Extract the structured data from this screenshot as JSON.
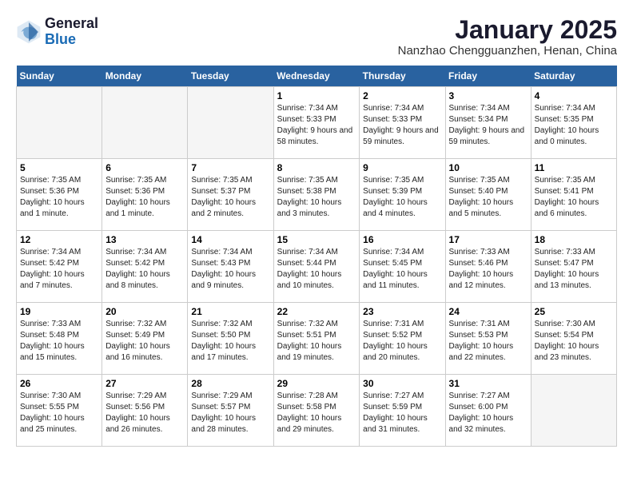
{
  "header": {
    "logo_general": "General",
    "logo_blue": "Blue",
    "month_title": "January 2025",
    "location": "Nanzhao Chengguanzhen, Henan, China"
  },
  "days_of_week": [
    "Sunday",
    "Monday",
    "Tuesday",
    "Wednesday",
    "Thursday",
    "Friday",
    "Saturday"
  ],
  "weeks": [
    [
      {
        "day": "",
        "info": ""
      },
      {
        "day": "",
        "info": ""
      },
      {
        "day": "",
        "info": ""
      },
      {
        "day": "1",
        "info": "Sunrise: 7:34 AM\nSunset: 5:33 PM\nDaylight: 9 hours and 58 minutes."
      },
      {
        "day": "2",
        "info": "Sunrise: 7:34 AM\nSunset: 5:33 PM\nDaylight: 9 hours and 59 minutes."
      },
      {
        "day": "3",
        "info": "Sunrise: 7:34 AM\nSunset: 5:34 PM\nDaylight: 9 hours and 59 minutes."
      },
      {
        "day": "4",
        "info": "Sunrise: 7:34 AM\nSunset: 5:35 PM\nDaylight: 10 hours and 0 minutes."
      }
    ],
    [
      {
        "day": "5",
        "info": "Sunrise: 7:35 AM\nSunset: 5:36 PM\nDaylight: 10 hours and 1 minute."
      },
      {
        "day": "6",
        "info": "Sunrise: 7:35 AM\nSunset: 5:36 PM\nDaylight: 10 hours and 1 minute."
      },
      {
        "day": "7",
        "info": "Sunrise: 7:35 AM\nSunset: 5:37 PM\nDaylight: 10 hours and 2 minutes."
      },
      {
        "day": "8",
        "info": "Sunrise: 7:35 AM\nSunset: 5:38 PM\nDaylight: 10 hours and 3 minutes."
      },
      {
        "day": "9",
        "info": "Sunrise: 7:35 AM\nSunset: 5:39 PM\nDaylight: 10 hours and 4 minutes."
      },
      {
        "day": "10",
        "info": "Sunrise: 7:35 AM\nSunset: 5:40 PM\nDaylight: 10 hours and 5 minutes."
      },
      {
        "day": "11",
        "info": "Sunrise: 7:35 AM\nSunset: 5:41 PM\nDaylight: 10 hours and 6 minutes."
      }
    ],
    [
      {
        "day": "12",
        "info": "Sunrise: 7:34 AM\nSunset: 5:42 PM\nDaylight: 10 hours and 7 minutes."
      },
      {
        "day": "13",
        "info": "Sunrise: 7:34 AM\nSunset: 5:42 PM\nDaylight: 10 hours and 8 minutes."
      },
      {
        "day": "14",
        "info": "Sunrise: 7:34 AM\nSunset: 5:43 PM\nDaylight: 10 hours and 9 minutes."
      },
      {
        "day": "15",
        "info": "Sunrise: 7:34 AM\nSunset: 5:44 PM\nDaylight: 10 hours and 10 minutes."
      },
      {
        "day": "16",
        "info": "Sunrise: 7:34 AM\nSunset: 5:45 PM\nDaylight: 10 hours and 11 minutes."
      },
      {
        "day": "17",
        "info": "Sunrise: 7:33 AM\nSunset: 5:46 PM\nDaylight: 10 hours and 12 minutes."
      },
      {
        "day": "18",
        "info": "Sunrise: 7:33 AM\nSunset: 5:47 PM\nDaylight: 10 hours and 13 minutes."
      }
    ],
    [
      {
        "day": "19",
        "info": "Sunrise: 7:33 AM\nSunset: 5:48 PM\nDaylight: 10 hours and 15 minutes."
      },
      {
        "day": "20",
        "info": "Sunrise: 7:32 AM\nSunset: 5:49 PM\nDaylight: 10 hours and 16 minutes."
      },
      {
        "day": "21",
        "info": "Sunrise: 7:32 AM\nSunset: 5:50 PM\nDaylight: 10 hours and 17 minutes."
      },
      {
        "day": "22",
        "info": "Sunrise: 7:32 AM\nSunset: 5:51 PM\nDaylight: 10 hours and 19 minutes."
      },
      {
        "day": "23",
        "info": "Sunrise: 7:31 AM\nSunset: 5:52 PM\nDaylight: 10 hours and 20 minutes."
      },
      {
        "day": "24",
        "info": "Sunrise: 7:31 AM\nSunset: 5:53 PM\nDaylight: 10 hours and 22 minutes."
      },
      {
        "day": "25",
        "info": "Sunrise: 7:30 AM\nSunset: 5:54 PM\nDaylight: 10 hours and 23 minutes."
      }
    ],
    [
      {
        "day": "26",
        "info": "Sunrise: 7:30 AM\nSunset: 5:55 PM\nDaylight: 10 hours and 25 minutes."
      },
      {
        "day": "27",
        "info": "Sunrise: 7:29 AM\nSunset: 5:56 PM\nDaylight: 10 hours and 26 minutes."
      },
      {
        "day": "28",
        "info": "Sunrise: 7:29 AM\nSunset: 5:57 PM\nDaylight: 10 hours and 28 minutes."
      },
      {
        "day": "29",
        "info": "Sunrise: 7:28 AM\nSunset: 5:58 PM\nDaylight: 10 hours and 29 minutes."
      },
      {
        "day": "30",
        "info": "Sunrise: 7:27 AM\nSunset: 5:59 PM\nDaylight: 10 hours and 31 minutes."
      },
      {
        "day": "31",
        "info": "Sunrise: 7:27 AM\nSunset: 6:00 PM\nDaylight: 10 hours and 32 minutes."
      },
      {
        "day": "",
        "info": ""
      }
    ]
  ]
}
